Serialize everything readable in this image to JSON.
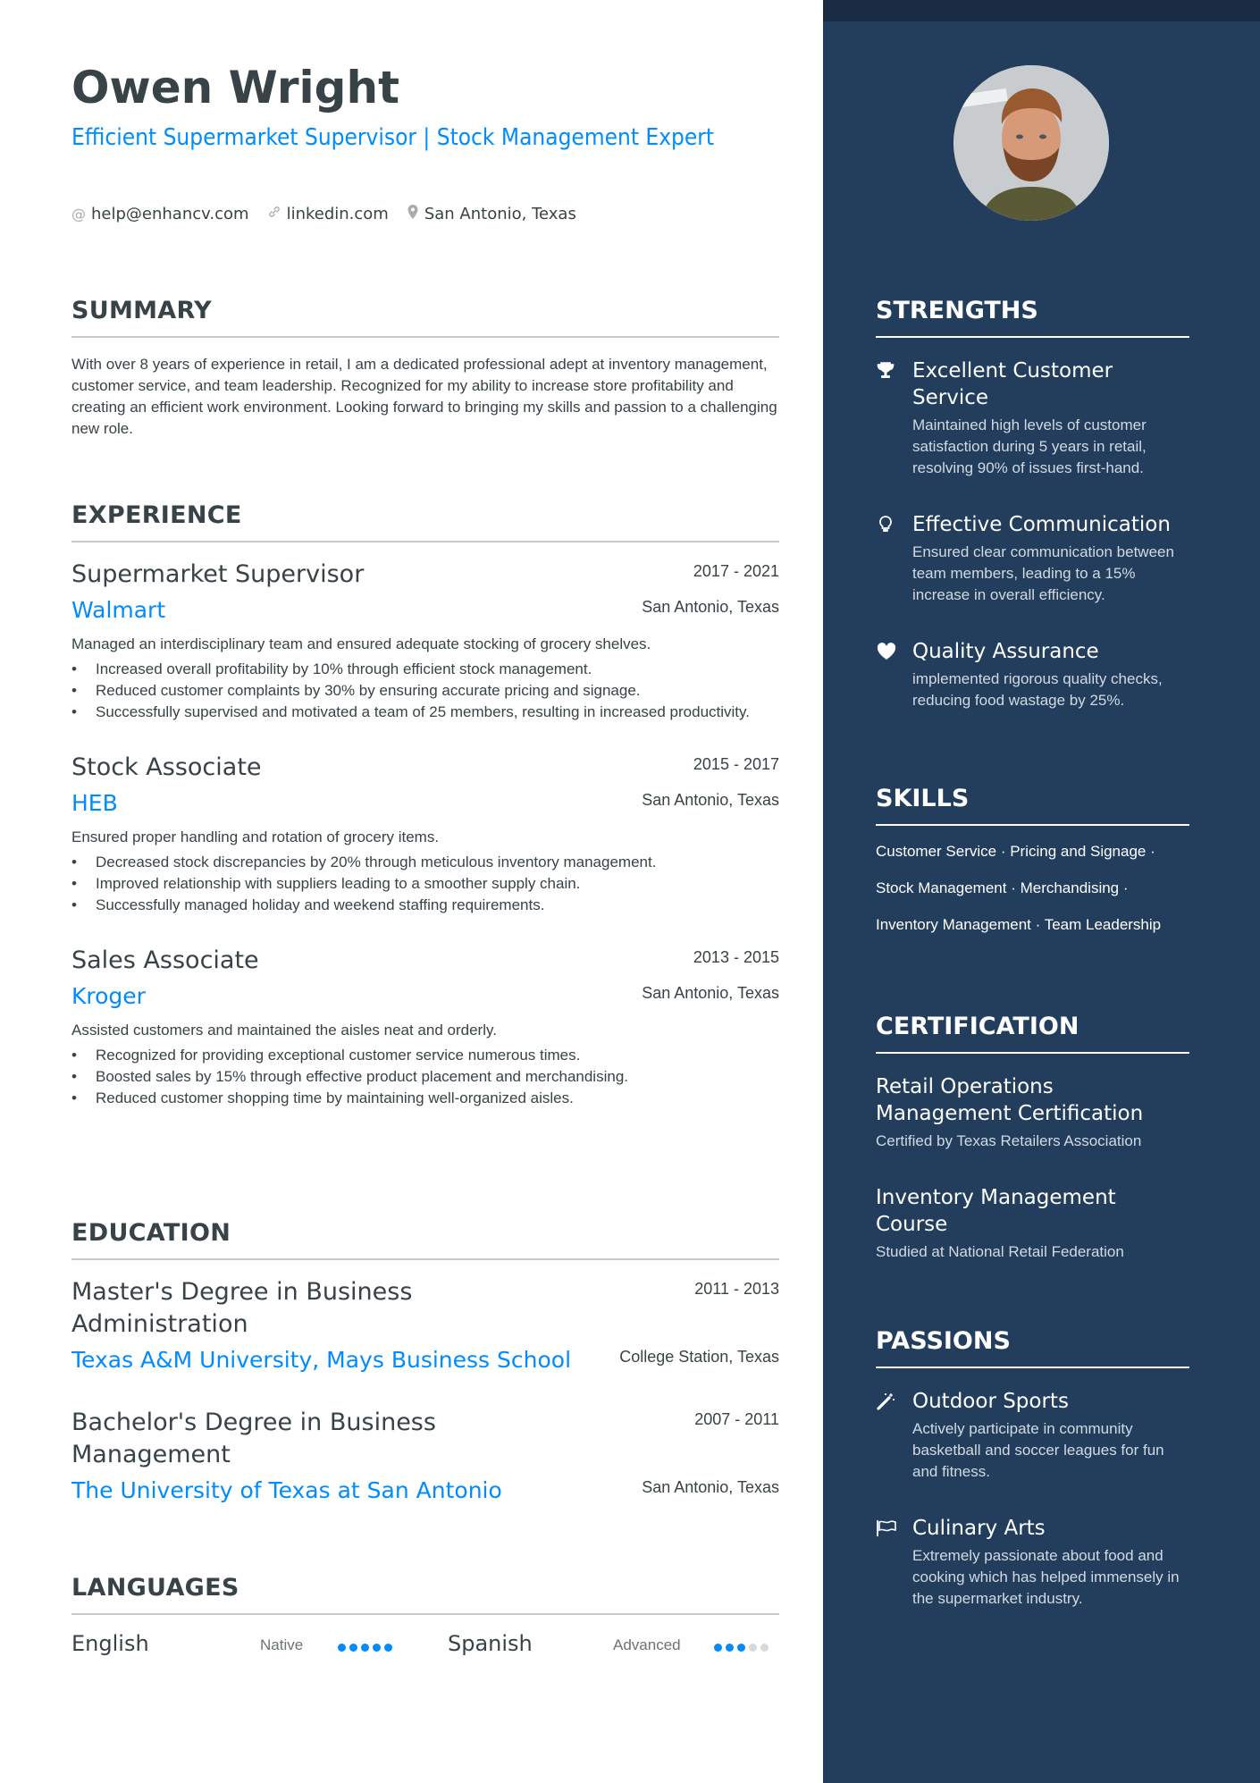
{
  "header": {
    "name": "Owen Wright",
    "headline": "Efficient Supermarket Supervisor | Stock Management Expert",
    "contacts": [
      {
        "icon": "at-icon",
        "text": "help@enhancv.com"
      },
      {
        "icon": "link-icon",
        "text": "linkedin.com"
      },
      {
        "icon": "location-pin-icon",
        "text": "San Antonio, Texas"
      }
    ]
  },
  "summary": {
    "title": "SUMMARY",
    "text": "With over 8 years of experience in retail, I am a dedicated professional adept at inventory management, customer service, and team leadership. Recognized for my ability to increase store profitability and creating an efficient work environment.  Looking forward to bringing my skills and passion to a challenging new role."
  },
  "experience": {
    "title": "EXPERIENCE",
    "jobs": [
      {
        "title": "Supermarket Supervisor",
        "dates": "2017 - 2021",
        "company": "Walmart",
        "location": "San Antonio, Texas",
        "description": "Managed an interdisciplinary team and ensured adequate stocking of grocery shelves.",
        "bullets": [
          "Increased overall profitability by 10% through efficient stock management.",
          "Reduced customer complaints by 30% by ensuring accurate pricing and signage.",
          "Successfully supervised and motivated a team of 25 members, resulting in increased productivity."
        ]
      },
      {
        "title": "Stock Associate",
        "dates": "2015 - 2017",
        "company": "HEB",
        "location": "San Antonio, Texas",
        "description": "Ensured proper handling and rotation of grocery items.",
        "bullets": [
          "Decreased stock discrepancies by 20% through meticulous inventory management.",
          "Improved relationship with suppliers leading to a smoother supply chain.",
          "Successfully managed holiday and weekend staffing requirements."
        ]
      },
      {
        "title": "Sales Associate",
        "dates": "2013 - 2015",
        "company": "Kroger",
        "location": "San Antonio, Texas",
        "description": "Assisted customers and maintained the aisles neat and orderly.",
        "bullets": [
          "Recognized for providing exceptional customer service numerous times.",
          "Boosted sales by 15% through effective product placement and merchandising.",
          "Reduced customer shopping time by maintaining well-organized aisles."
        ]
      }
    ]
  },
  "education": {
    "title": "EDUCATION",
    "items": [
      {
        "degree": "Master's Degree in Business Administration",
        "dates": "2011 - 2013",
        "school": "Texas A&M University, Mays Business School",
        "location": "College Station, Texas"
      },
      {
        "degree": "Bachelor's Degree in Business Management",
        "dates": "2007 - 2011",
        "school": "The University of Texas at San Antonio",
        "location": "San Antonio, Texas"
      }
    ]
  },
  "languages": {
    "title": "LANGUAGES",
    "items": [
      {
        "name": "English",
        "level": "Native",
        "rating": 5,
        "max": 5
      },
      {
        "name": "Spanish",
        "level": "Advanced",
        "rating": 3,
        "max": 5
      }
    ]
  },
  "sidebar": {
    "photo_alt": "Profile photo of Owen Wright",
    "strengths": {
      "title": "STRENGTHS",
      "items": [
        {
          "icon": "trophy-icon",
          "title": "Excellent Customer Service",
          "description": "Maintained high levels of customer satisfaction during 5 years in retail, resolving 90% of issues first-hand."
        },
        {
          "icon": "lightbulb-icon",
          "title": "Effective Communication",
          "description": "Ensured clear communication between team members, leading to a 15% increase in overall efficiency."
        },
        {
          "icon": "heart-icon",
          "title": "Quality Assurance",
          "description": "implemented rigorous quality checks, reducing food wastage by 25%."
        }
      ]
    },
    "skills": {
      "title": "SKILLS",
      "items": [
        "Customer Service",
        "Pricing and Signage",
        "Stock Management",
        "Merchandising",
        "Inventory Management",
        "Team Leadership"
      ]
    },
    "certification": {
      "title": "CERTIFICATION",
      "items": [
        {
          "title": "Retail Operations Management Certification",
          "description": "Certified by Texas Retailers Association"
        },
        {
          "title": "Inventory Management Course",
          "description": "Studied at National Retail Federation"
        }
      ]
    },
    "passions": {
      "title": "PASSIONS",
      "items": [
        {
          "icon": "magic-wand-icon",
          "title": "Outdoor Sports",
          "description": "Actively participate in community basketball and soccer leagues for fun and fitness."
        },
        {
          "icon": "flag-icon",
          "title": "Culinary Arts",
          "description": "Extremely passionate about food and cooking which has helped immensely in the supermarket industry."
        }
      ]
    }
  },
  "colors": {
    "accent": "#008cff",
    "text": "#384347",
    "sidebar_bg": "#223e5c",
    "sidebar_top": "#1a2c44",
    "dot_off": "#d7dadc"
  }
}
